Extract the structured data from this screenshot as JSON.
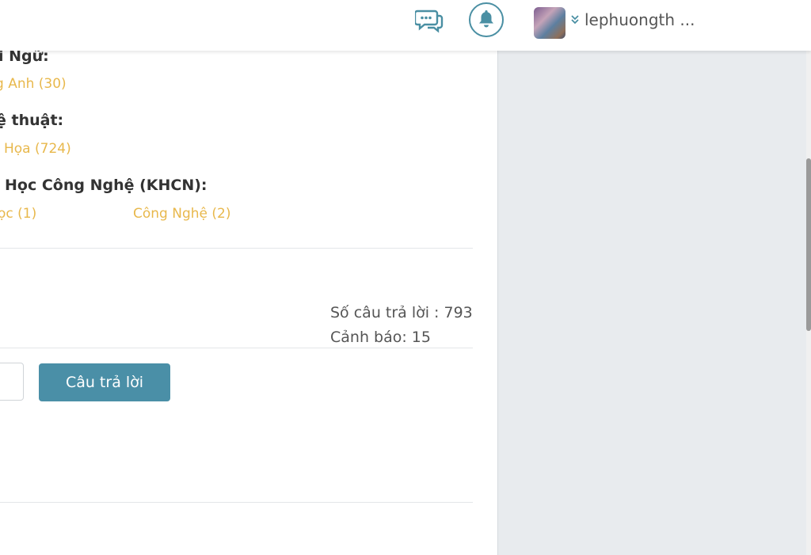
{
  "header": {
    "username": "lephuongth ...",
    "chat_icon": "chat-bubbles-icon",
    "bell_icon": "bell-icon",
    "chevron_icon": "double-chevron-down-icon"
  },
  "categories": [
    {
      "title": "i Ngữ:",
      "items": [
        "g Anh (30)"
      ]
    },
    {
      "title": "ệ thuật:",
      "items": [
        "Họa (724)"
      ]
    },
    {
      "title": "Học Công Nghệ (KHCN):",
      "items": [
        "ọc (1)",
        "Công Nghệ (2)"
      ]
    }
  ],
  "stats": {
    "answers": "Số câu trả lời : 793",
    "warnings": "Cảnh báo: 15"
  },
  "actions": {
    "answer_button": "Câu trả lời"
  },
  "colors": {
    "accent": "#4a8fa7",
    "category_link": "#e8b84c",
    "right_panel_bg": "#e8ebee"
  }
}
